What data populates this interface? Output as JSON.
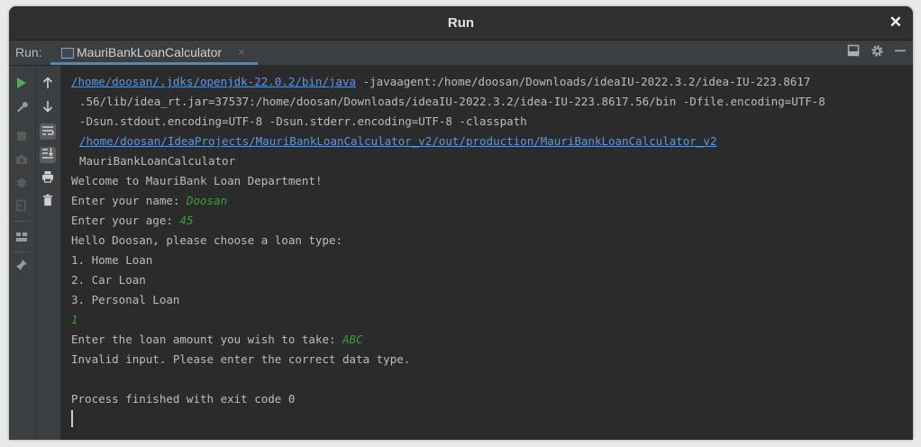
{
  "window": {
    "title": "Run",
    "close_glyph": "✕"
  },
  "toolbar": {
    "run_label": "Run:",
    "tab_label": "MauriBankLoanCalculator",
    "tab_close": "×",
    "right_icons": [
      "layout-icon",
      "gear-icon",
      "minimize-icon"
    ]
  },
  "gutter": {
    "left_icons": [
      "run-icon",
      "wrench-icon",
      "stop-icon",
      "camera-icon",
      "bug-icon",
      "exit-icon",
      "layout-grid-icon",
      "pin-icon"
    ],
    "right_icons": [
      "arrow-up-icon",
      "arrow-down-icon",
      "soft-wrap-icon",
      "scroll-to-end-icon",
      "print-icon",
      "trash-icon"
    ]
  },
  "console": {
    "cmd_java_path": "/home/doosan/.jdks/openjdk-22.0.2/bin/java",
    "cmd_line1_rest": " -javaagent:/home/doosan/Downloads/ideaIU-2022.3.2/idea-IU-223.8617",
    "cmd_line2": ".56/lib/idea_rt.jar=37537:/home/doosan/Downloads/ideaIU-2022.3.2/idea-IU-223.8617.56/bin -Dfile.encoding=UTF-8",
    "cmd_line3": "-Dsun.stdout.encoding=UTF-8 -Dsun.stderr.encoding=UTF-8 -classpath",
    "cmd_classpath": "/home/doosan/IdeaProjects/MauriBankLoanCalculator_v2/out/production/MauriBankLoanCalculator_v2",
    "cmd_main_class": "MauriBankLoanCalculator",
    "welcome": "Welcome to MauriBank Loan Department!",
    "name_prompt": "Enter your name: ",
    "name_input": "Doosan",
    "age_prompt": "Enter your age: ",
    "age_input": "45",
    "hello": "Hello Doosan, please choose a loan type:",
    "option1": "1. Home Loan",
    "option2": "2. Car Loan",
    "option3": "3. Personal Loan",
    "choice_input": "1",
    "amount_prompt": "Enter the loan amount you wish to take: ",
    "amount_input": "ABC",
    "error": "Invalid input. Please enter the correct data type.",
    "exit": "Process finished with exit code 0"
  },
  "colors": {
    "background": "#2b2b2b",
    "link": "#5f97db",
    "user_input": "#3f9b3f",
    "text": "#bcbcbc",
    "tab_underline": "#4a88c7"
  }
}
